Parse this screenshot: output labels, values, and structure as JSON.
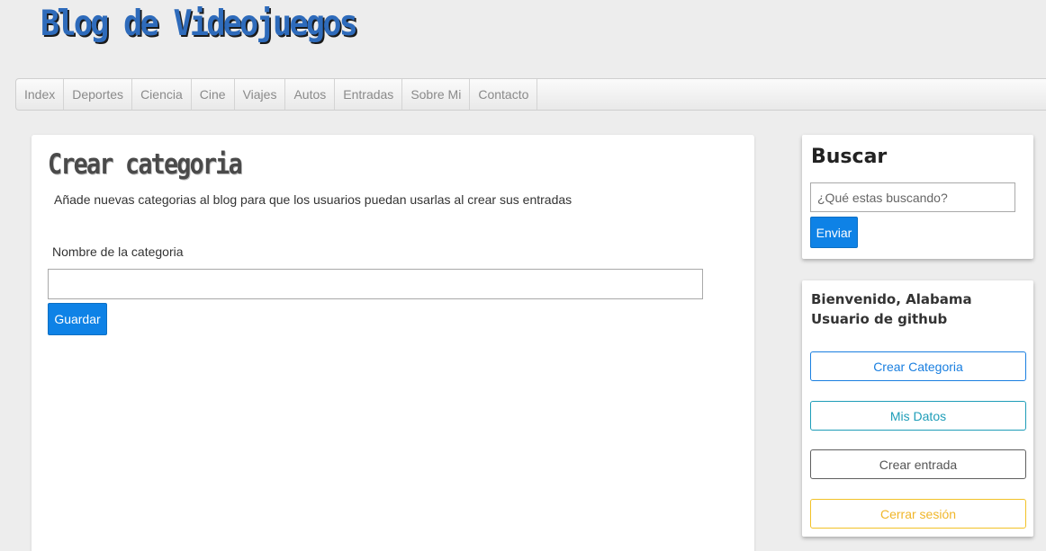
{
  "site": {
    "title": "Blog de Videojuegos"
  },
  "nav": {
    "items": [
      {
        "label": "Index"
      },
      {
        "label": "Deportes"
      },
      {
        "label": "Ciencia"
      },
      {
        "label": "Cine"
      },
      {
        "label": "Viajes"
      },
      {
        "label": "Autos"
      },
      {
        "label": "Entradas"
      },
      {
        "label": "Sobre Mi"
      },
      {
        "label": "Contacto"
      }
    ]
  },
  "main": {
    "title": "Crear categoria",
    "description": "Añade nuevas categorias al blog para que los usuarios puedan usarlas al crear sus entradas",
    "field_label": "Nombre de la categoria",
    "field_value": "",
    "save_label": "Guardar"
  },
  "sidebar": {
    "search": {
      "title": "Buscar",
      "placeholder": "¿Qué estas buscando?",
      "submit_label": "Enviar"
    },
    "user": {
      "welcome": "Bienvenido, Alabama Usuario de github",
      "buttons": [
        {
          "label": "Crear Categoria"
        },
        {
          "label": "Mis Datos"
        },
        {
          "label": "Crear entrada"
        },
        {
          "label": "Cerrar sesión"
        }
      ]
    }
  },
  "colors": {
    "brand_blue": "#2e6bbb",
    "primary_button": "#0e82e6",
    "info_outline": "#1e9db8",
    "warning_outline": "#f2c227"
  }
}
